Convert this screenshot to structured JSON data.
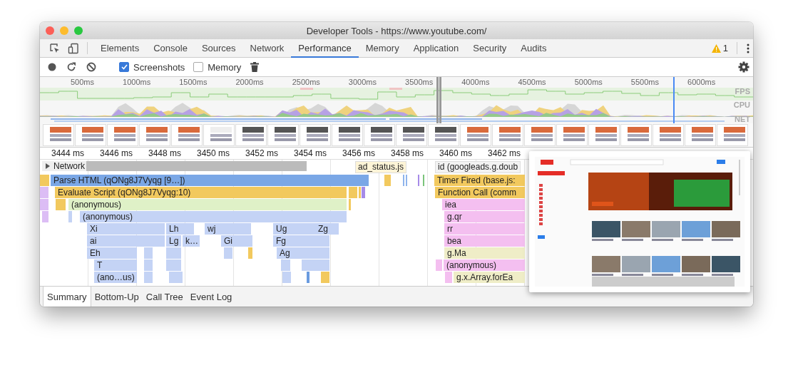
{
  "window": {
    "title": "Developer Tools - https://www.youtube.com/"
  },
  "tabs": [
    {
      "label": "Elements",
      "selected": false
    },
    {
      "label": "Console",
      "selected": false
    },
    {
      "label": "Sources",
      "selected": false
    },
    {
      "label": "Network",
      "selected": false
    },
    {
      "label": "Performance",
      "selected": true
    },
    {
      "label": "Memory",
      "selected": false
    },
    {
      "label": "Application",
      "selected": false
    },
    {
      "label": "Security",
      "selected": false
    },
    {
      "label": "Audits",
      "selected": false
    }
  ],
  "warnings": {
    "count": "1"
  },
  "toolbar": {
    "checkboxes": [
      {
        "label": "Screenshots",
        "checked": true
      },
      {
        "label": "Memory",
        "checked": false
      }
    ]
  },
  "overview": {
    "ticks": [
      "500ms",
      "1000ms",
      "1500ms",
      "2000ms",
      "2500ms",
      "3000ms",
      "3500ms",
      "4000ms",
      "4500ms",
      "5000ms",
      "5500ms",
      "6000ms"
    ],
    "tracks": [
      "FPS",
      "CPU",
      "NET"
    ]
  },
  "timeline": {
    "ticks": [
      "3444 ms",
      "3446 ms",
      "3448 ms",
      "3450 ms",
      "3452 ms",
      "3454 ms",
      "3456 ms",
      "3458 ms",
      "3460 ms",
      "3462 ms"
    ]
  },
  "network": {
    "label": "Network",
    "expanded": false,
    "requests": [
      {
        "label": "ad_status.js"
      },
      {
        "label": "id (googleads.g.doub"
      }
    ]
  },
  "flame_chart": {
    "entries": [
      {
        "label": "Parse HTML (qONg8J7Vyqg [9…])",
        "kind": "parse"
      },
      {
        "label": "Evaluate Script (qONg8J7Vyqg:10)",
        "kind": "script"
      },
      {
        "label": "(anonymous)",
        "kind": "anon"
      },
      {
        "label": "(anonymous)",
        "kind": "js"
      },
      {
        "label": "Xi",
        "kind": "js"
      },
      {
        "label": "Lh",
        "kind": "js"
      },
      {
        "label": "wj",
        "kind": "js"
      },
      {
        "label": "Ug",
        "kind": "js"
      },
      {
        "label": "Zg",
        "kind": "js"
      },
      {
        "label": "ai",
        "kind": "js"
      },
      {
        "label": "Lg",
        "kind": "js"
      },
      {
        "label": "k…",
        "kind": "js"
      },
      {
        "label": "Gi",
        "kind": "js"
      },
      {
        "label": "Fg",
        "kind": "js"
      },
      {
        "label": "Eh",
        "kind": "js"
      },
      {
        "label": "Ag",
        "kind": "js"
      },
      {
        "label": "T",
        "kind": "js"
      },
      {
        "label": "(ano…us)",
        "kind": "js"
      },
      {
        "label": "Timer Fired (base.js:",
        "kind": "script"
      },
      {
        "label": "Function Call (comm",
        "kind": "script"
      },
      {
        "label": "iea",
        "kind": "pink"
      },
      {
        "label": "g.qr",
        "kind": "pink"
      },
      {
        "label": "rr",
        "kind": "pink"
      },
      {
        "label": "bea",
        "kind": "pink"
      },
      {
        "label": "g.Ma",
        "kind": "khaki"
      },
      {
        "label": "(anonymous)",
        "kind": "pink"
      },
      {
        "label": "g.x.Array.forEa",
        "kind": "khaki"
      }
    ]
  },
  "bottom_tabs": [
    {
      "label": "Summary",
      "selected": true
    },
    {
      "label": "Bottom-Up",
      "selected": false
    },
    {
      "label": "Call Tree",
      "selected": false
    },
    {
      "label": "Event Log",
      "selected": false
    }
  ]
}
